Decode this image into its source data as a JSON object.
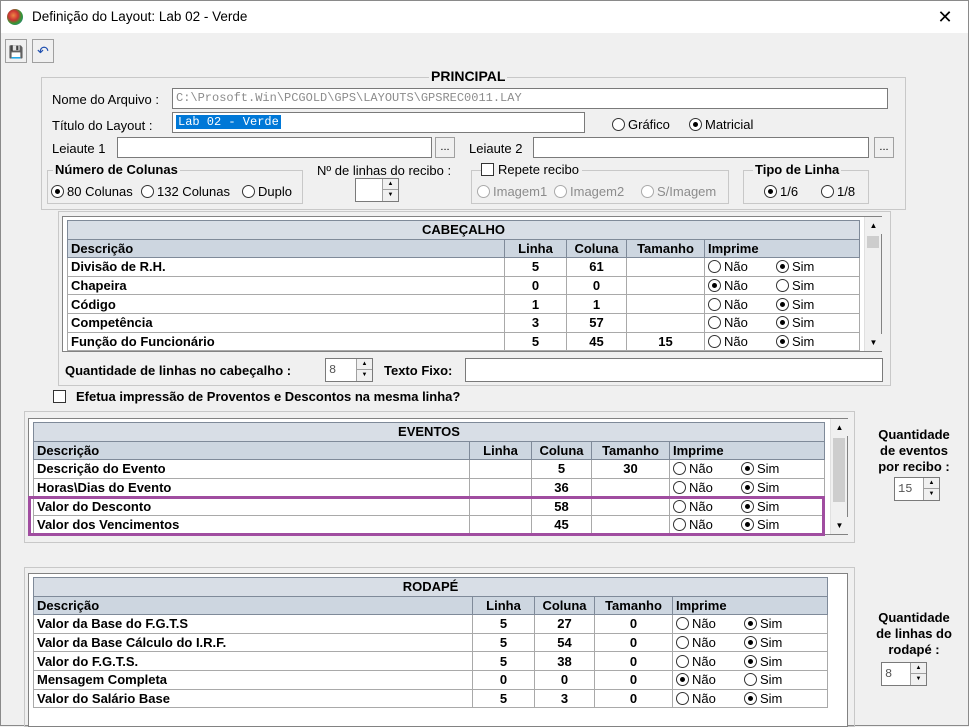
{
  "window": {
    "title": "Definição do Layout: Lab 02 - Verde",
    "close": "✕"
  },
  "toolbar": {
    "save_icon": "save-icon",
    "undo_icon": "undo-icon",
    "save_glyph": "💾",
    "undo_glyph": "↶"
  },
  "principal": {
    "title": "PRINCIPAL",
    "nome_label": "Nome do Arquivo :",
    "nome_value": "C:\\Prosoft.Win\\PCGOLD\\GPS\\LAYOUTS\\GPSREC0011.LAY",
    "titulo_label": "Título do Layout :",
    "titulo_value": "Lab 02 - Verde",
    "grafico": "Gráfico",
    "matricial": "Matricial",
    "leiaute1": "Leiaute 1",
    "leiaute2": "Leiaute 2",
    "browse": "...",
    "colunas_title": "Número de Colunas",
    "col80": "80 Colunas",
    "col132": "132 Colunas",
    "duplo": "Duplo",
    "nlinhas_label": "Nº de linhas do recibo :",
    "repete": "Repete recibo",
    "img1": "Imagem1",
    "img2": "Imagem2",
    "simg": "S/Imagem",
    "tipo_title": "Tipo de Linha",
    "t16": "1/6",
    "t18": "1/8"
  },
  "cabecalho": {
    "caption": "CABEÇALHO",
    "headers": [
      "Descrição",
      "Linha",
      "Coluna",
      "Tamanho",
      "Imprime"
    ],
    "rows": [
      {
        "d": "Divisão de R.H.",
        "l": "5",
        "c": "61",
        "t": "",
        "imp": "sim"
      },
      {
        "d": "Chapeira",
        "l": "0",
        "c": "0",
        "t": "",
        "imp": "nao"
      },
      {
        "d": "Código",
        "l": "1",
        "c": "1",
        "t": "",
        "imp": "sim"
      },
      {
        "d": "Competência",
        "l": "3",
        "c": "57",
        "t": "",
        "imp": "sim"
      },
      {
        "d": "Função do Funcionário",
        "l": "5",
        "c": "45",
        "t": "15",
        "imp": "sim"
      }
    ],
    "qtd_label": "Quantidade de linhas no cabeçalho :",
    "qtd_value": "8",
    "texto_fixo": "Texto Fixo:"
  },
  "efetua_label": "Efetua impressão de Proventos e Descontos na mesma linha?",
  "eventos": {
    "caption": "EVENTOS",
    "headers": [
      "Descrição",
      "Linha",
      "Coluna",
      "Tamanho",
      "Imprime"
    ],
    "rows": [
      {
        "d": "Descrição do Evento",
        "l": "",
        "c": "5",
        "t": "30",
        "imp": "sim"
      },
      {
        "d": "Horas\\Dias do Evento",
        "l": "",
        "c": "36",
        "t": "",
        "imp": "sim"
      },
      {
        "d": "Valor do Desconto",
        "l": "",
        "c": "58",
        "t": "",
        "imp": "sim"
      },
      {
        "d": "Valor dos Vencimentos",
        "l": "",
        "c": "45",
        "t": "",
        "imp": "sim"
      }
    ],
    "qtd_l1": "Quantidade",
    "qtd_l2": "de eventos",
    "qtd_l3": "por recibo :",
    "qtd_value": "15"
  },
  "rodape": {
    "caption": "RODAPÉ",
    "headers": [
      "Descrição",
      "Linha",
      "Coluna",
      "Tamanho",
      "Imprime"
    ],
    "rows": [
      {
        "d": "Valor da Base do F.G.T.S",
        "l": "5",
        "c": "27",
        "t": "0",
        "imp": "sim"
      },
      {
        "d": "Valor da Base Cálculo do I.R.F.",
        "l": "5",
        "c": "54",
        "t": "0",
        "imp": "sim"
      },
      {
        "d": "Valor do F.G.T.S.",
        "l": "5",
        "c": "38",
        "t": "0",
        "imp": "sim"
      },
      {
        "d": "Mensagem Completa",
        "l": "0",
        "c": "0",
        "t": "0",
        "imp": "nao"
      },
      {
        "d": "Valor do Salário Base",
        "l": "5",
        "c": "3",
        "t": "0",
        "imp": "sim"
      }
    ],
    "qtd_l1": "Quantidade",
    "qtd_l2": "de linhas do",
    "qtd_l3": "rodapé :",
    "qtd_value": "8"
  },
  "opts": {
    "nao": "Não",
    "sim": "Sim"
  },
  "colors": {
    "highlight": "#a04da0",
    "selection": "#0078d7",
    "grid_header": "#cdd6e0"
  }
}
